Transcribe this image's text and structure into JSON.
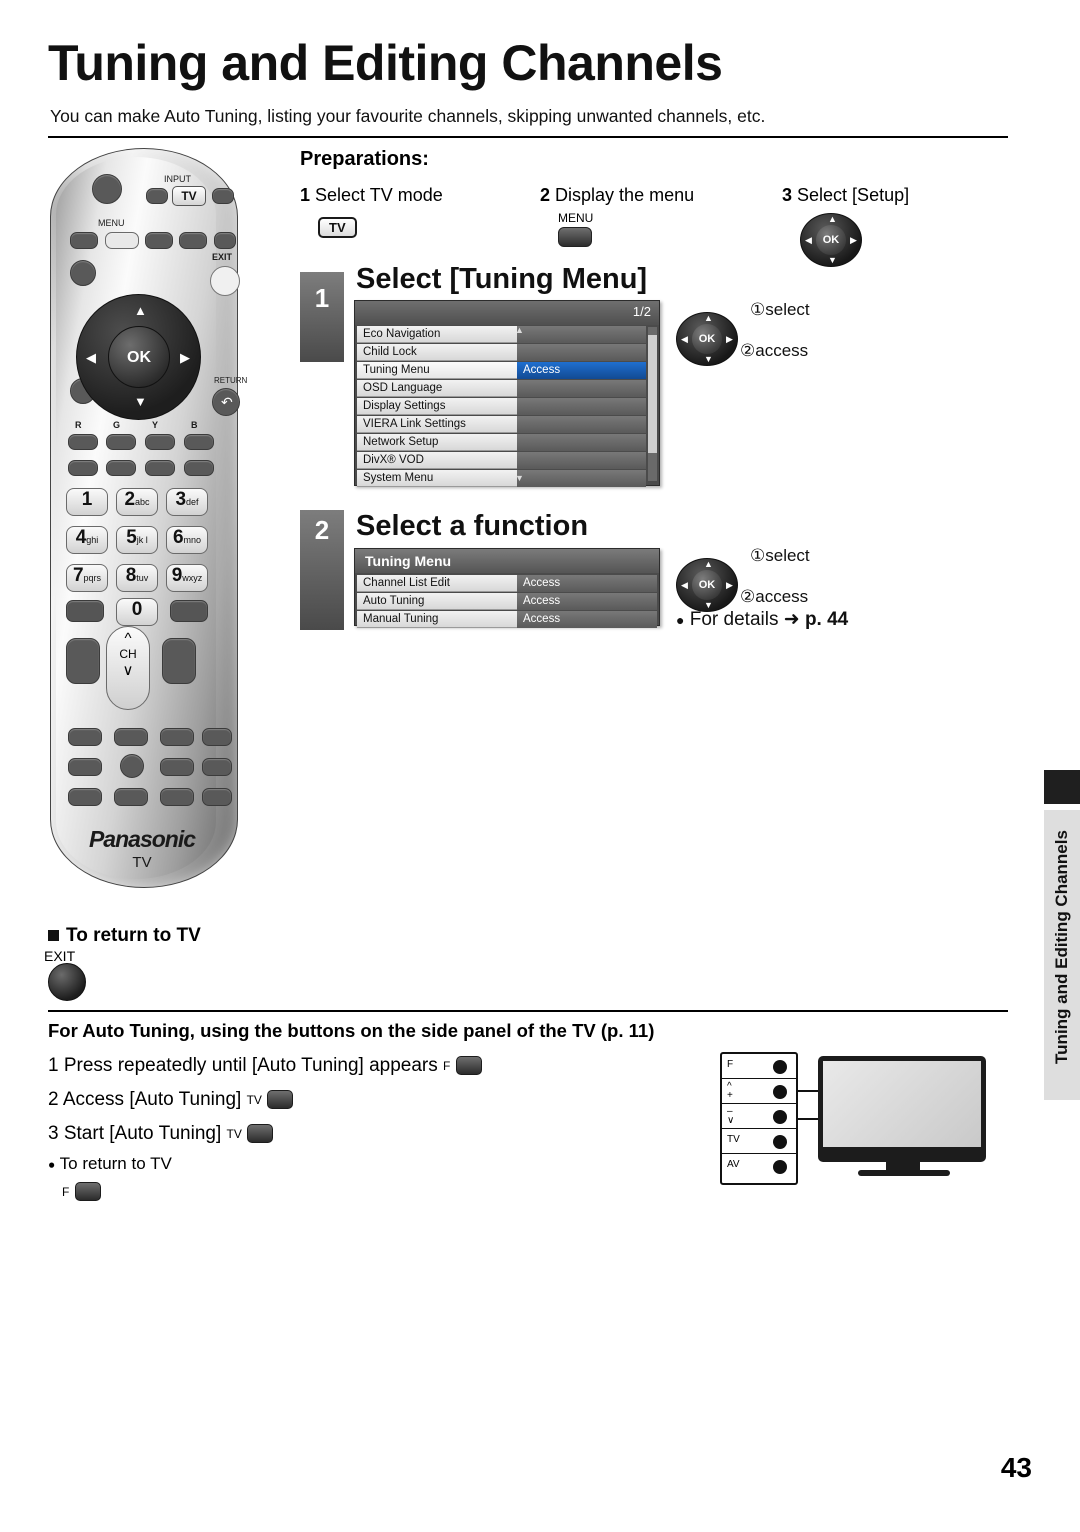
{
  "page": {
    "title": "Tuning and Editing Channels",
    "subtitle": "You can make Auto Tuning, listing your favourite channels, skipping unwanted channels, etc.",
    "number": "43",
    "side_tab": "Tuning and Editing Channels"
  },
  "preparations": {
    "heading": "Preparations:",
    "steps": [
      {
        "num": "1",
        "text": "Select TV mode",
        "key": "TV"
      },
      {
        "num": "2",
        "text": "Display the menu",
        "key": "MENU"
      },
      {
        "num": "3",
        "text": "Select [Setup]",
        "key": "OK"
      }
    ]
  },
  "step1": {
    "num": "1",
    "heading": "Select [Tuning Menu]",
    "osd": {
      "page_indicator": "1/2",
      "rows": [
        {
          "label": "Eco Navigation",
          "value": "",
          "selected": false
        },
        {
          "label": "Child Lock",
          "value": "",
          "selected": false
        },
        {
          "label": "Tuning Menu",
          "value": "Access",
          "selected": true
        },
        {
          "label": "OSD Language",
          "value": "",
          "selected": false
        },
        {
          "label": "Display Settings",
          "value": "",
          "selected": false
        },
        {
          "label": "VIERA Link Settings",
          "value": "",
          "selected": false
        },
        {
          "label": "Network Setup",
          "value": "",
          "selected": false
        },
        {
          "label": "DivX® VOD",
          "value": "",
          "selected": false
        },
        {
          "label": "System Menu",
          "value": "",
          "selected": false
        }
      ]
    },
    "hint_select": "①select",
    "hint_access": "②access",
    "ok_label": "OK"
  },
  "step2": {
    "num": "2",
    "heading": "Select a function",
    "osd": {
      "title": "Tuning Menu",
      "rows": [
        {
          "label": "Channel List Edit",
          "value": "Access"
        },
        {
          "label": "Auto Tuning",
          "value": "Access"
        },
        {
          "label": "Manual Tuning",
          "value": "Access"
        }
      ]
    },
    "hint_select": "①select",
    "hint_access": "②access",
    "details_prefix": "For details",
    "details_arrow": "➜",
    "details_page": "p. 44",
    "ok_label": "OK"
  },
  "return_to_tv": {
    "heading": "To return to TV",
    "key_label": "EXIT"
  },
  "auto_tuning": {
    "heading": "For Auto Tuning, using the buttons on the side panel of the TV (p. 11)",
    "lines": [
      {
        "num": "1",
        "text": "Press repeatedly until [Auto Tuning] appears",
        "key": "F"
      },
      {
        "num": "2",
        "text": "Access [Auto Tuning]",
        "key": "TV"
      },
      {
        "num": "3",
        "text": "Start [Auto Tuning]",
        "key": "TV"
      }
    ],
    "return_text": "To return to TV",
    "return_key": "F",
    "side_panel_buttons": [
      "F",
      "^\n+",
      "–\n∨",
      "TV",
      "AV"
    ]
  },
  "remote": {
    "labels": {
      "input": "INPUT",
      "tv": "TV",
      "menu": "MENU",
      "exit": "EXIT",
      "ok": "OK",
      "return": "RETURN",
      "color_r": "R",
      "color_g": "G",
      "color_y": "Y",
      "color_b": "B",
      "ch": "CH",
      "brand": "Panasonic",
      "brand_sub": "TV"
    },
    "keypad": [
      {
        "n": "1",
        "s": ""
      },
      {
        "n": "2",
        "s": "abc"
      },
      {
        "n": "3",
        "s": "def"
      },
      {
        "n": "4",
        "s": "ghi"
      },
      {
        "n": "5",
        "s": "jk l"
      },
      {
        "n": "6",
        "s": "mno"
      },
      {
        "n": "7",
        "s": "pqrs"
      },
      {
        "n": "8",
        "s": "tuv"
      },
      {
        "n": "9",
        "s": "wxyz"
      },
      {
        "n": "0",
        "s": ""
      }
    ]
  }
}
